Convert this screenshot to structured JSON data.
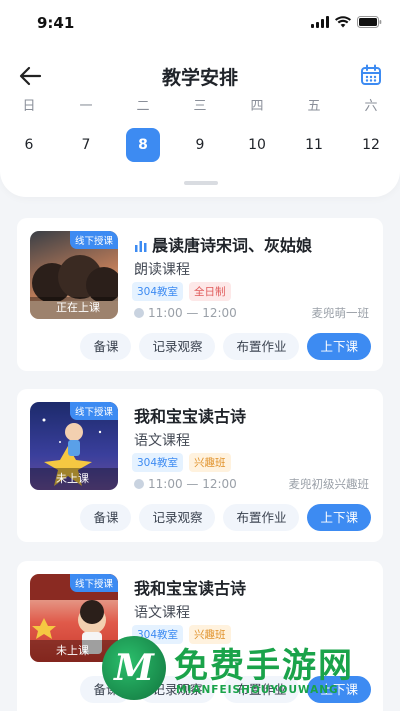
{
  "status_bar": {
    "time": "9:41"
  },
  "header": {
    "title": "教学安排"
  },
  "week": {
    "weekdays": [
      "日",
      "一",
      "二",
      "三",
      "四",
      "五",
      "六"
    ],
    "dates": [
      "6",
      "7",
      "8",
      "9",
      "10",
      "11",
      "12"
    ],
    "selected_date": "8"
  },
  "courses": [
    {
      "thumb_tag": "线下授课",
      "thumb_status": "正在上课",
      "title": "晨读唐诗宋词、灰姑娘",
      "type": "朗读课程",
      "tags": [
        "304教室",
        "全日制"
      ],
      "time": "11:00 — 12:00",
      "class_name": "麦兜萌一班",
      "actions": [
        "备课",
        "记录观察",
        "布置作业",
        "上下课"
      ]
    },
    {
      "thumb_tag": "线下授课",
      "thumb_status": "未上课",
      "title": "我和宝宝读古诗",
      "type": "语文课程",
      "tags": [
        "304教室",
        "兴趣班"
      ],
      "time": "11:00 — 12:00",
      "class_name": "麦兜初级兴趣班",
      "actions": [
        "备课",
        "记录观察",
        "布置作业",
        "上下课"
      ]
    },
    {
      "thumb_tag": "线下授课",
      "thumb_status": "未上课",
      "title": "我和宝宝读古诗",
      "type": "语文课程",
      "tags": [
        "304教室",
        "兴趣班"
      ],
      "actions": [
        "备课",
        "记录观察",
        "布置作业",
        "上下课"
      ]
    }
  ],
  "watermark": {
    "text": "免费手游网",
    "sub": "MIANFEISHOUYOUWANG",
    "logo_letter": "M"
  },
  "colors": {
    "accent": "#3d8bf2",
    "tag_red": "#e05a5a",
    "tag_orange": "#e0922b",
    "watermark": "#1aa34a"
  },
  "icons": [
    "back-arrow-icon",
    "calendar-icon",
    "signal-icon",
    "wifi-icon",
    "battery-icon",
    "clock-icon",
    "live-bars-icon"
  ]
}
